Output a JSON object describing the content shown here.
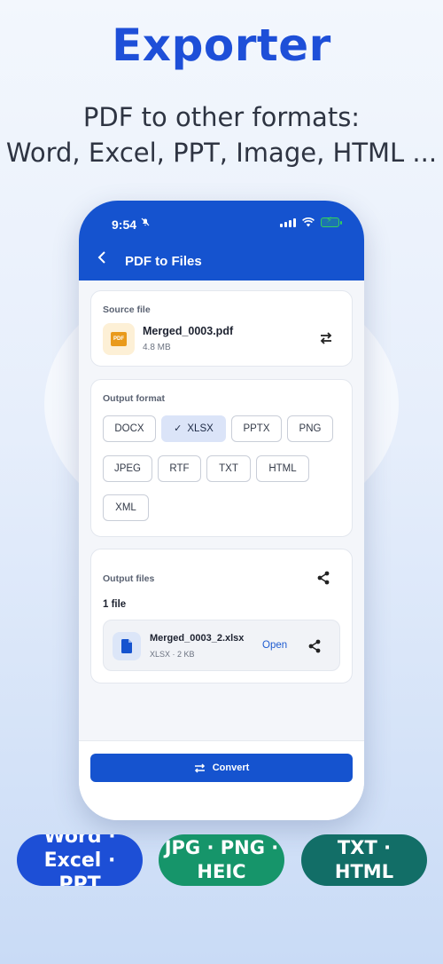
{
  "headline": "Exporter",
  "subline": {
    "line1": "PDF to other formats:",
    "line2": "Word, Excel, PPT, Image, HTML ..."
  },
  "status_bar": {
    "time": "9:54"
  },
  "nav": {
    "title": "PDF to Files",
    "back_icon": "chevron-left-icon"
  },
  "source": {
    "label": "Source file",
    "file_name": "Merged_0003.pdf",
    "file_size": "4.8 MB",
    "thumb_text": "PDF"
  },
  "output_format": {
    "label": "Output format",
    "options": [
      "DOCX",
      "XLSX",
      "PPTX",
      "PNG",
      "JPEG",
      "RTF",
      "TXT",
      "HTML",
      "XML"
    ],
    "selected": "XLSX"
  },
  "output_files": {
    "label": "Output files",
    "count": "1 file",
    "items": [
      {
        "name": "Merged_0003_2.xlsx",
        "meta": "XLSX · 2 KB",
        "open_label": "Open"
      }
    ]
  },
  "convert_label": "Convert",
  "pills": {
    "word": {
      "line1": "Word ·",
      "line2": "Excel · PPT"
    },
    "image": {
      "line1": "JPG · PNG ·",
      "line2": "HEIC"
    },
    "text": {
      "line1": "TXT · HTML"
    }
  },
  "colors": {
    "brand_blue": "#1553cf",
    "headline_blue": "#1e4fd8",
    "pill_green": "#16956a",
    "pill_teal": "#126e67",
    "pdf_orange": "#e99a1b"
  }
}
